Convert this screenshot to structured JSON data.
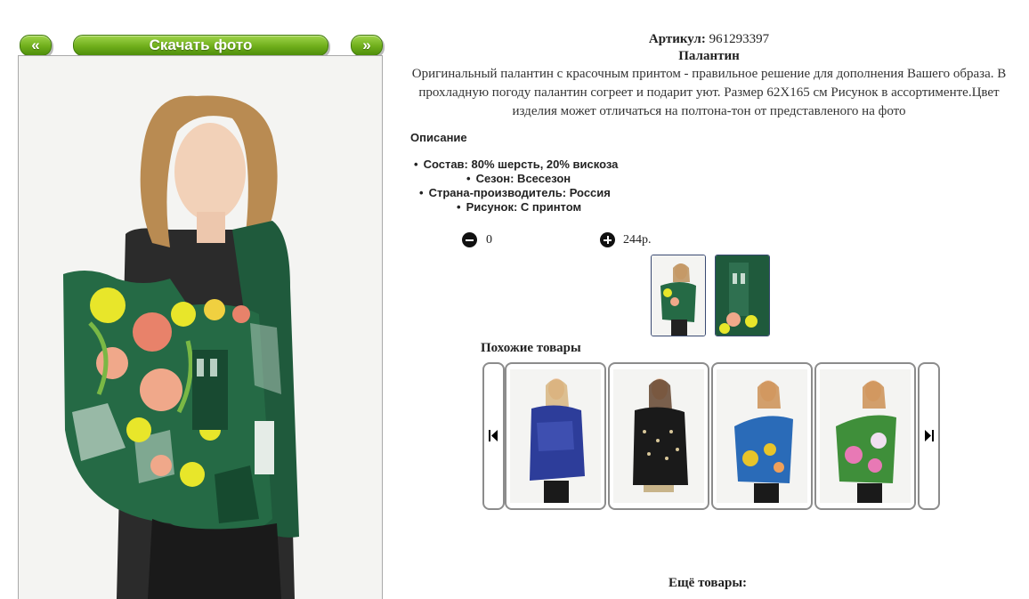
{
  "gallery": {
    "prev_label": "«",
    "download_label": "Скачать фото",
    "next_label": "»"
  },
  "product": {
    "article_label": "Артикул:",
    "article_value": "961293397",
    "name": "Палантин",
    "description_line1": "Оригинальный палантин с красочным принтом - правильное решение для дополнения Вашего образа. В",
    "description_line2": "прохладную погоду палантин согреет и подарит уют. Размер 62X165 см Рисунок в ассортименте.Цвет",
    "description_line3": "изделия может отличаться на полтона-тон от представленого на фото",
    "description_title": "Описание",
    "attributes": [
      "Состав: 80% шерсть, 20% вискоза",
      "Сезон: Всесезон",
      "Страна-производитель: Россия",
      "Рисунок: С принтом"
    ],
    "quantity": "0",
    "price": "244р."
  },
  "similar": {
    "title": "Похожие товары",
    "items": [
      {
        "color": "#2d3d9a"
      },
      {
        "color": "#1a1a1a"
      },
      {
        "color": "#2a6bb8"
      },
      {
        "color": "#3f8f3a"
      }
    ]
  },
  "more_title": "Ещё товары:",
  "colors": {
    "button_green": "#6fae1b",
    "scarf_green": "#1f5a3c",
    "flower_yellow": "#e8e62a",
    "flower_peach": "#f0a88a",
    "thumb_border": "#3a4a72"
  }
}
